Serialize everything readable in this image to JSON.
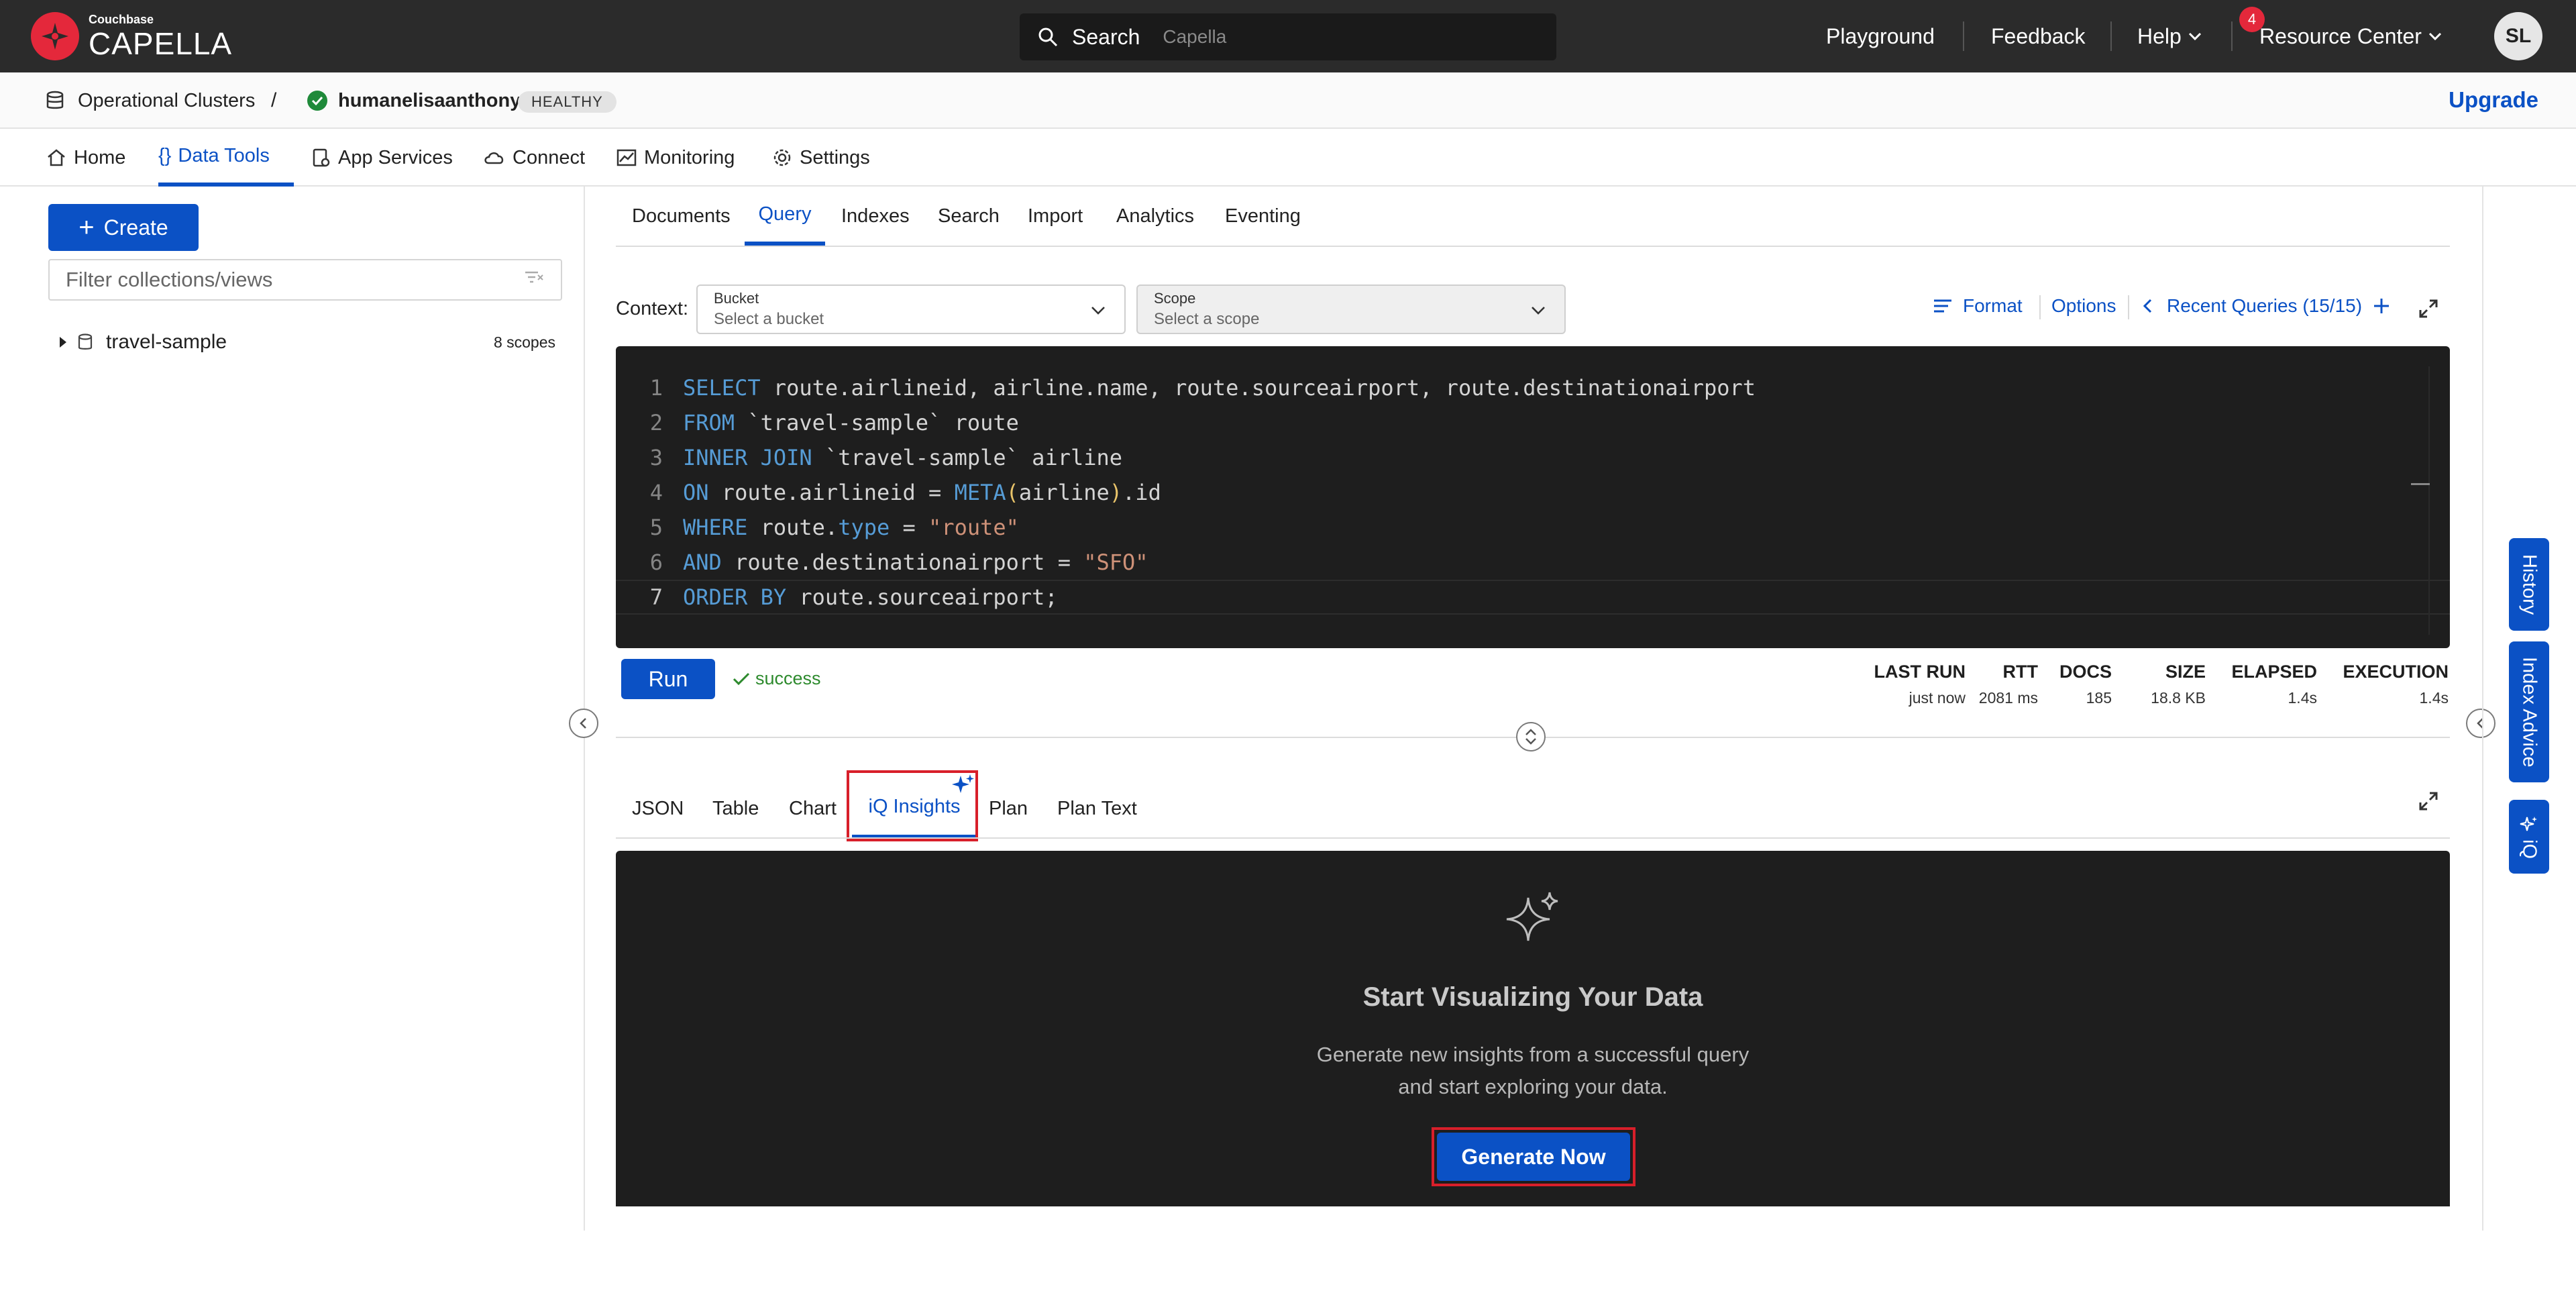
{
  "topbar": {
    "brand_small": "Couchbase",
    "brand_big": "CAPELLA",
    "search_label": "Search",
    "search_placeholder": "Capella",
    "nav": {
      "playground": "Playground",
      "feedback": "Feedback",
      "help": "Help",
      "resource_center": "Resource Center",
      "notification_count": "4"
    },
    "avatar_initials": "SL"
  },
  "breadcrumb": {
    "clusters": "Operational Clusters",
    "separator": "/",
    "cluster_name": "humanelisaanthony",
    "health": "HEALTHY",
    "upgrade": "Upgrade"
  },
  "main_tabs": {
    "home": "Home",
    "data_tools": "Data Tools",
    "app_services": "App Services",
    "connect": "Connect",
    "monitoring": "Monitoring",
    "settings": "Settings",
    "active": "Data Tools"
  },
  "left": {
    "create": "Create",
    "filter_placeholder": "Filter collections/views",
    "tree": [
      {
        "name": "travel-sample",
        "meta": "8 scopes"
      }
    ]
  },
  "sub_tabs": {
    "documents": "Documents",
    "query": "Query",
    "indexes": "Indexes",
    "search": "Search",
    "import": "Import",
    "analytics": "Analytics",
    "eventing": "Eventing",
    "active": "Query"
  },
  "context": {
    "label": "Context:",
    "bucket_title": "Bucket",
    "bucket_value": "Select a bucket",
    "scope_title": "Scope",
    "scope_value": "Select a scope"
  },
  "toolbar": {
    "format": "Format",
    "options": "Options",
    "recent": "Recent Queries (15/15)"
  },
  "editor": {
    "line_numbers": [
      "1",
      "2",
      "3",
      "4",
      "5",
      "6",
      "7"
    ]
  },
  "run": {
    "label": "Run",
    "status": "success"
  },
  "stats": {
    "last_run": {
      "h": "LAST RUN",
      "v": "just now"
    },
    "rtt": {
      "h": "RTT",
      "v": "2081 ms"
    },
    "docs": {
      "h": "DOCS",
      "v": "185"
    },
    "size": {
      "h": "SIZE",
      "v": "18.8 KB"
    },
    "elapsed": {
      "h": "ELAPSED",
      "v": "1.4s"
    },
    "execution": {
      "h": "EXECUTION",
      "v": "1.4s"
    }
  },
  "result_tabs": {
    "json": "JSON",
    "table": "Table",
    "chart": "Chart",
    "insights": "iQ Insights",
    "plan": "Plan",
    "plan_text": "Plan Text",
    "active": "iQ Insights"
  },
  "insights": {
    "title": "Start Visualizing Your Data",
    "line1": "Generate new insights from a successful query",
    "line2": "and start exploring your data.",
    "button": "Generate Now"
  },
  "right_rail": {
    "history": "History",
    "index_advice": "Index Advice",
    "iq": "iQ"
  },
  "colors": {
    "accent": "#0b51c5",
    "topbar": "#2b2b2b",
    "brand_red": "#e4283b",
    "editor_bg": "#1e1e1e",
    "highlight": "#d81f2a",
    "success": "#2d8a2d"
  }
}
